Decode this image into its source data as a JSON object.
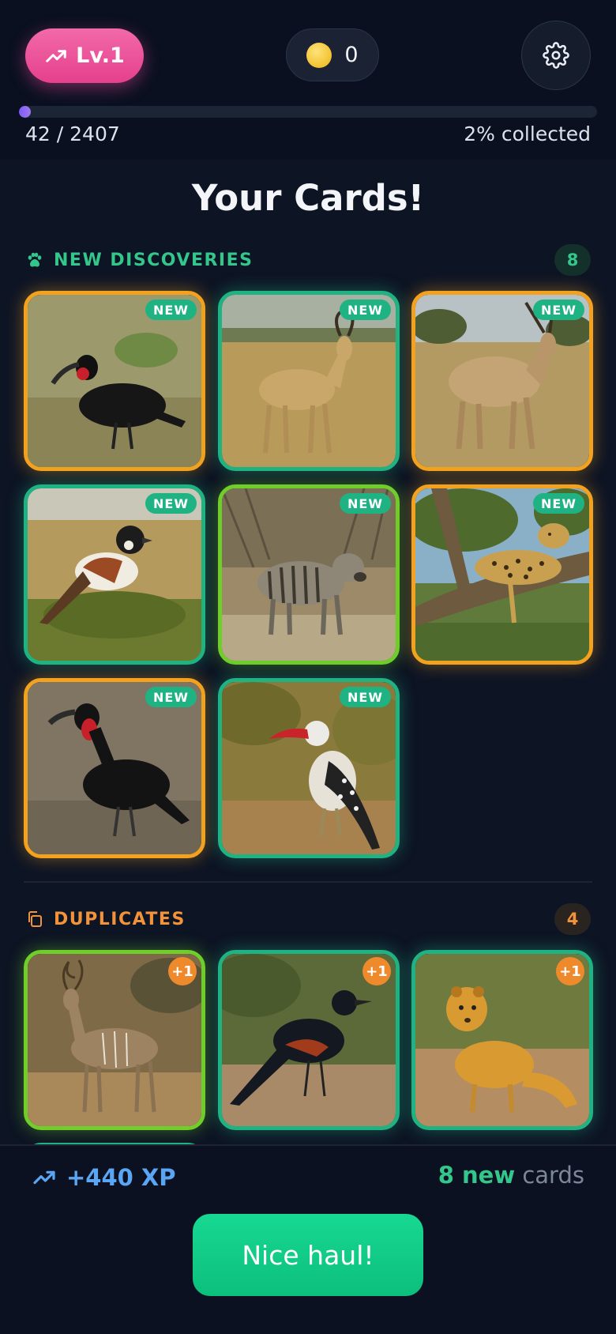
{
  "header": {
    "level_label": "Lv.1",
    "coins": "0",
    "progress_fraction": 0.02,
    "progress_count": "42 / 2407",
    "progress_percent": "2% collected"
  },
  "title": "Your Cards!",
  "sections": {
    "new": {
      "label": "NEW DISCOVERIES",
      "count": "8",
      "badge": "NEW"
    },
    "duplicates": {
      "label": "DUPLICATES",
      "count": "4",
      "badge": "+1"
    }
  },
  "new_cards": [
    {
      "animal": "southern-ground-hornbill",
      "border": "orange"
    },
    {
      "animal": "hartebeest",
      "border": "teal"
    },
    {
      "animal": "eland",
      "border": "orange"
    },
    {
      "animal": "sparrow-weaver",
      "border": "teal"
    },
    {
      "animal": "striped-hyena",
      "border": "lime"
    },
    {
      "animal": "leopard",
      "border": "orange"
    },
    {
      "animal": "ground-hornbill",
      "border": "orange"
    },
    {
      "animal": "red-billed-hornbill",
      "border": "teal"
    }
  ],
  "duplicate_cards": [
    {
      "animal": "kudu",
      "border": "lime"
    },
    {
      "animal": "red-winged-starling",
      "border": "teal"
    },
    {
      "animal": "yellow-mongoose",
      "border": "teal"
    }
  ],
  "footer": {
    "xp": "+440 XP",
    "new_count": "8 new",
    "new_suffix": "cards",
    "cta": "Nice haul!"
  },
  "colors": {
    "accent_green": "#34c78b",
    "accent_orange": "#f2933a",
    "level_pink": "#ec4899",
    "xp_blue": "#5aa6f5",
    "border_orange": "#f2a21e",
    "border_teal": "#1fb383",
    "border_lime": "#6fce2a"
  }
}
